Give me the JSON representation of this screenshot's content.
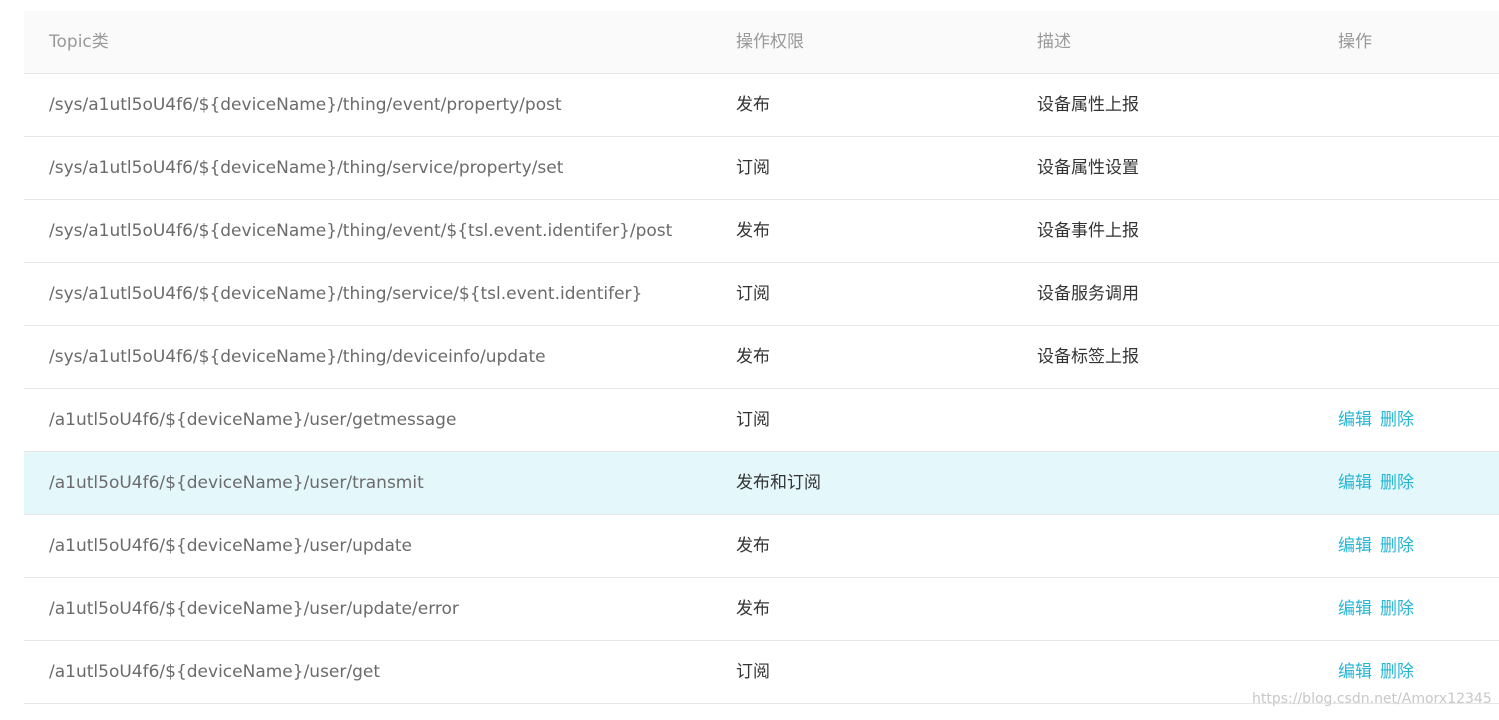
{
  "columns": {
    "topic": "Topic类",
    "permission": "操作权限",
    "description": "描述",
    "actions": "操作"
  },
  "rows": [
    {
      "topic": "/sys/a1utl5oU4f6/${deviceName}/thing/event/property/post",
      "permission": "发布",
      "description": "设备属性上报",
      "edit": "",
      "delete": ""
    },
    {
      "topic": "/sys/a1utl5oU4f6/${deviceName}/thing/service/property/set",
      "permission": "订阅",
      "description": "设备属性设置",
      "edit": "",
      "delete": ""
    },
    {
      "topic": "/sys/a1utl5oU4f6/${deviceName}/thing/event/${tsl.event.identifer}/post",
      "permission": "发布",
      "description": "设备事件上报",
      "edit": "",
      "delete": ""
    },
    {
      "topic": "/sys/a1utl5oU4f6/${deviceName}/thing/service/${tsl.event.identifer}",
      "permission": "订阅",
      "description": "设备服务调用",
      "edit": "",
      "delete": ""
    },
    {
      "topic": "/sys/a1utl5oU4f6/${deviceName}/thing/deviceinfo/update",
      "permission": "发布",
      "description": "设备标签上报",
      "edit": "",
      "delete": ""
    },
    {
      "topic": "/a1utl5oU4f6/${deviceName}/user/getmessage",
      "permission": "订阅",
      "description": "",
      "edit": "编辑",
      "delete": "删除"
    },
    {
      "topic": "/a1utl5oU4f6/${deviceName}/user/transmit",
      "permission": "发布和订阅",
      "description": "",
      "edit": "编辑",
      "delete": "删除"
    },
    {
      "topic": "/a1utl5oU4f6/${deviceName}/user/update",
      "permission": "发布",
      "description": "",
      "edit": "编辑",
      "delete": "删除"
    },
    {
      "topic": "/a1utl5oU4f6/${deviceName}/user/update/error",
      "permission": "发布",
      "description": "",
      "edit": "编辑",
      "delete": "删除"
    },
    {
      "topic": "/a1utl5oU4f6/${deviceName}/user/get",
      "permission": "订阅",
      "description": "",
      "edit": "编辑",
      "delete": "删除"
    }
  ],
  "highlighted_row": 6,
  "colors": {
    "link": "#26b6d6",
    "highlight_row": "#e4f7fb",
    "header_bg": "#fafafa"
  },
  "watermark": "https://blog.csdn.net/Amorx12345"
}
